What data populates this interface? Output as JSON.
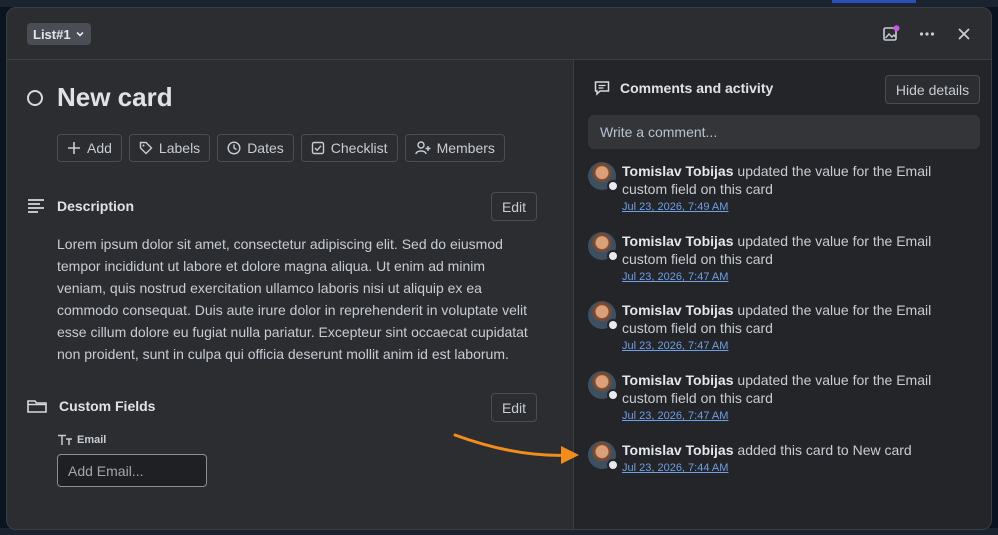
{
  "header": {
    "list_label": "List#1",
    "icons": [
      "cover-image-icon",
      "more-icon",
      "close-icon"
    ],
    "cover_badge_color": "#c659e0"
  },
  "card": {
    "title": "New card",
    "actions": [
      {
        "label": "Add",
        "icon": "plus-icon"
      },
      {
        "label": "Labels",
        "icon": "tag-icon"
      },
      {
        "label": "Dates",
        "icon": "clock-icon"
      },
      {
        "label": "Checklist",
        "icon": "checkbox-icon"
      },
      {
        "label": "Members",
        "icon": "add-person-icon"
      }
    ]
  },
  "description": {
    "title": "Description",
    "edit_label": "Edit",
    "text": "Lorem ipsum dolor sit amet, consectetur adipiscing elit. Sed do eiusmod tempor incididunt ut labore et dolore magna aliqua. Ut enim ad minim veniam, quis nostrud exercitation ullamco laboris nisi ut aliquip ex ea commodo consequat. Duis aute irure dolor in reprehenderit in voluptate velit esse cillum dolore eu fugiat nulla pariatur. Excepteur sint occaecat cupidatat non proident, sunt in culpa qui officia deserunt mollit anim id est laborum."
  },
  "custom_fields": {
    "title": "Custom Fields",
    "edit_label": "Edit",
    "email_label": "Email",
    "email_placeholder": "Add Email..."
  },
  "comments": {
    "title": "Comments and activity",
    "hide_label": "Hide details",
    "placeholder": "Write a comment...",
    "activity": [
      {
        "user": "Tomislav Tobijas",
        "text": " updated the value for the Email custom field on this card",
        "date": "Jul 23, 2026, 7:49 AM"
      },
      {
        "user": "Tomislav Tobijas",
        "text": " updated the value for the Email custom field on this card",
        "date": "Jul 23, 2026, 7:47 AM"
      },
      {
        "user": "Tomislav Tobijas",
        "text": " updated the value for the Email custom field on this card",
        "date": "Jul 23, 2026, 7:47 AM"
      },
      {
        "user": "Tomislav Tobijas",
        "text": " updated the value for the Email custom field on this card",
        "date": "Jul 23, 2026, 7:47 AM"
      },
      {
        "user": "Tomislav Tobijas",
        "text": " added this card to New card",
        "date": "Jul 23, 2026, 7:44 AM"
      }
    ]
  },
  "colors": {
    "accent_link": "#6f9fe6",
    "arrow": "#f28c1c"
  }
}
